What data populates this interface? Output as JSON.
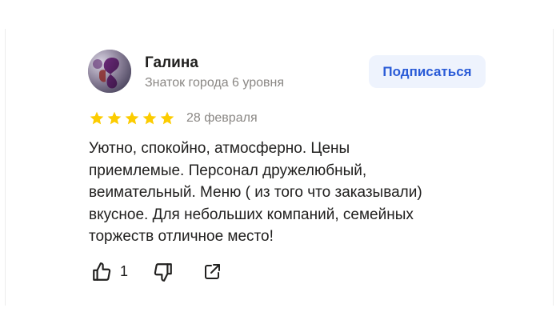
{
  "author": {
    "name": "Галина",
    "level": "Знаток города 6 уровня",
    "avatar_icon": "avatar-photo"
  },
  "subscribe_label": "Подписаться",
  "review": {
    "rating": 5,
    "max_rating": 5,
    "date": "28 февраля",
    "text_lines": [
      "Уютно, спокойно, атмосферно. Цены",
      "приемлемые. Персонал дружелюбный,",
      "веимательный. Меню ( из того что заказывали)",
      "вкусное. Для небольших компаний, семейных",
      "торжеств отличное место!"
    ]
  },
  "actions": {
    "like_icon": "thumbs-up-icon",
    "like_count": "1",
    "dislike_icon": "thumbs-down-icon",
    "share_icon": "share-icon"
  },
  "colors": {
    "star": "#fccc00",
    "accent_text": "#2a5bd7",
    "button_bg": "#eef3fd",
    "muted_text": "#8a8784",
    "primary_text": "#21201f"
  }
}
